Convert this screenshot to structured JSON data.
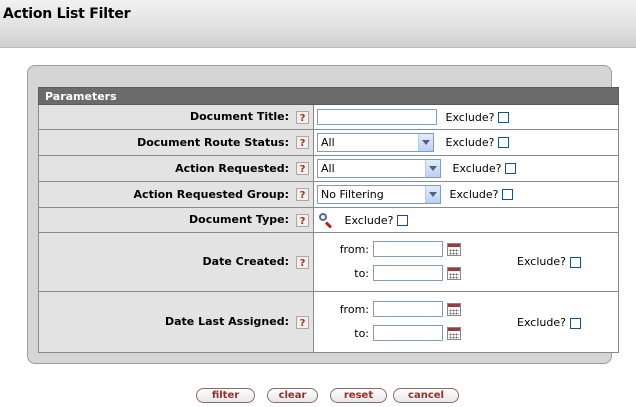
{
  "page": {
    "title": "Action List Filter"
  },
  "parameters": {
    "header": "Parameters",
    "exclude_label": "Exclude?",
    "rows": [
      {
        "label": "Document Title:"
      },
      {
        "label": "Document Route Status:",
        "selected": "All"
      },
      {
        "label": "Action Requested:",
        "selected": "All"
      },
      {
        "label": "Action Requested Group:",
        "selected": "No Filtering"
      },
      {
        "label": "Document Type:"
      },
      {
        "label": "Date Created:",
        "from_label": "from:",
        "to_label": "to:"
      },
      {
        "label": "Date Last Assigned:",
        "from_label": "from:",
        "to_label": "to:"
      }
    ],
    "help_glyph": "?"
  },
  "buttons": {
    "filter": "filter",
    "clear": "clear",
    "reset": "reset",
    "cancel": "cancel"
  },
  "colors": {
    "section_header": "#6b6b6b",
    "label_bg": "#e3e3e3",
    "button_text": "#9c2b2b",
    "help_icon": "#a4322c"
  }
}
